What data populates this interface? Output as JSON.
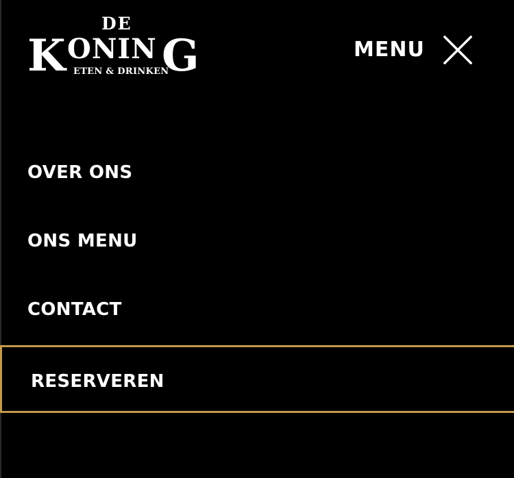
{
  "logo": {
    "de": "DE",
    "k": "K",
    "oning": "ONIN",
    "g": "G",
    "tagline": "ETEN & DRINKEN"
  },
  "header": {
    "menu_label": "MENU",
    "close_icon": "close-icon"
  },
  "nav": {
    "items": [
      {
        "label": "OVER ONS"
      },
      {
        "label": "ONS MENU"
      },
      {
        "label": "CONTACT"
      }
    ],
    "cta": {
      "label": "RESERVEREN"
    }
  },
  "colors": {
    "background": "#000000",
    "text": "#ffffff",
    "accent": "#c49a4a"
  }
}
